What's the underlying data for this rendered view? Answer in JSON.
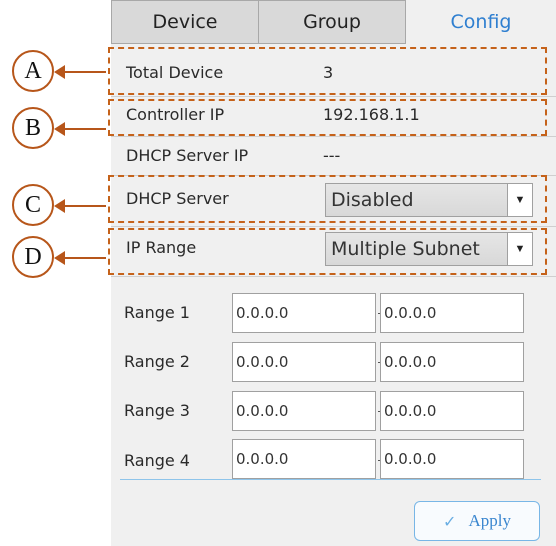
{
  "tabs": [
    {
      "label": "Device"
    },
    {
      "label": "Group"
    },
    {
      "label": "Config"
    }
  ],
  "info": {
    "total_device_label": "Total Device",
    "total_device_value": "3",
    "controller_ip_label": "Controller IP",
    "controller_ip_value": "192.168.1.1",
    "dhcp_server_ip_label": "DHCP Server IP",
    "dhcp_server_ip_value": "---",
    "dhcp_server_label": "DHCP Server",
    "dhcp_server_value": "Disabled",
    "ip_range_label": "IP Range",
    "ip_range_value": "Multiple Subnet"
  },
  "ranges": [
    {
      "label": "Range 1",
      "start": "0.0.0.0",
      "end": "0.0.0.0"
    },
    {
      "label": "Range 2",
      "start": "0.0.0.0",
      "end": "0.0.0.0"
    },
    {
      "label": "Range 3",
      "start": "0.0.0.0",
      "end": "0.0.0.0"
    },
    {
      "label": "Range 4",
      "start": "0.0.0.0",
      "end": "0.0.0.0"
    }
  ],
  "apply_label": "Apply",
  "callouts": [
    {
      "letter": "A"
    },
    {
      "letter": "B"
    },
    {
      "letter": "C"
    },
    {
      "letter": "D"
    }
  ],
  "colors": {
    "callout_orange": "#c5621a",
    "active_tab_blue": "#2f7fd0",
    "apply_blue": "#3a86cf"
  },
  "icons": {
    "dropdown": "caret-down-icon",
    "apply": "checkmark-icon"
  }
}
